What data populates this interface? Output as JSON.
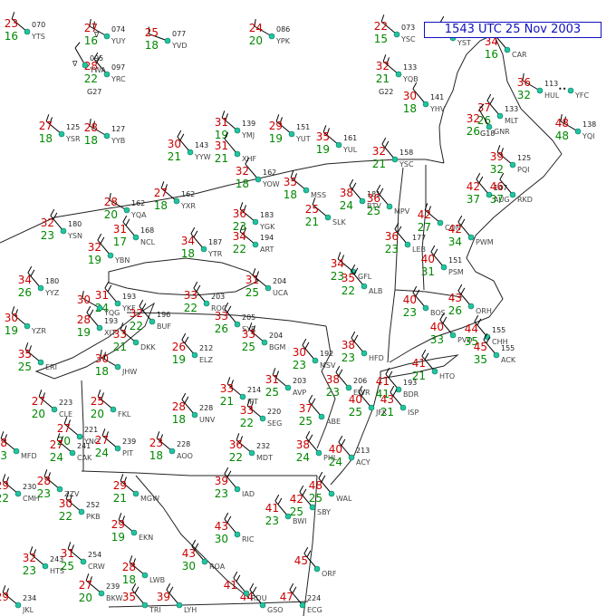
{
  "timestamp": "1543 UTC 25 Nov 2003",
  "colors": {
    "temperature": "#cc0000",
    "dewpoint": "#008800",
    "state_border": "#222222",
    "coastline": "#222222",
    "barb": "#000000",
    "station_dot": "#22c4a0",
    "timestamp_border": "#1010c0",
    "weather_symbol": "#aa00aa",
    "station_id": "#444444"
  },
  "stations": [
    {
      "id": "YTS",
      "t": "23",
      "d": "16",
      "p": "070"
    },
    {
      "id": "YUY",
      "t": "27",
      "d": "16",
      "p": "074",
      "wx": "∇"
    },
    {
      "id": "YVD",
      "t": "25",
      "d": "18",
      "p": "077"
    },
    {
      "id": "YPK",
      "t": "24",
      "d": "20",
      "p": "086"
    },
    {
      "id": "YRC",
      "t": "28",
      "d": "22",
      "p": "097",
      "g": "G27"
    },
    {
      "id": "YWA",
      "t": "",
      "d": "",
      "p": "095",
      "wx": "∇"
    },
    {
      "id": "YSC",
      "t": "22",
      "d": "15",
      "p": "073"
    },
    {
      "id": "YST",
      "t": "",
      "d": "",
      "p": "082"
    },
    {
      "id": "CAR",
      "t": "34",
      "d": "16",
      "p": ""
    },
    {
      "id": "HUL",
      "t": "36",
      "d": "32",
      "p": "113"
    },
    {
      "id": "YFC",
      "t": "",
      "d": "",
      "p": "",
      "wx": "••"
    },
    {
      "id": "YQB",
      "t": "32",
      "d": "21",
      "p": "133",
      "g": "G22"
    },
    {
      "id": "YHV",
      "t": "30",
      "d": "18",
      "p": "141"
    },
    {
      "id": "MLT",
      "t": "37",
      "d": "26",
      "p": "133",
      "g": "G18"
    },
    {
      "id": "GNR",
      "t": "32",
      "d": "26",
      "p": ""
    },
    {
      "id": "YQI",
      "t": "48",
      "d": "48",
      "p": "138"
    },
    {
      "id": "YSR",
      "t": "27",
      "d": "18",
      "p": "125"
    },
    {
      "id": "YYB",
      "t": "28",
      "d": "18",
      "p": "127"
    },
    {
      "id": "YMJ",
      "t": "31",
      "d": "19",
      "p": "139"
    },
    {
      "id": "YUT",
      "t": "29",
      "d": "19",
      "p": "151"
    },
    {
      "id": "YYW",
      "t": "30",
      "d": "21",
      "p": "143"
    },
    {
      "id": "XHF",
      "t": "31",
      "d": "21",
      "p": ""
    },
    {
      "id": "YUL",
      "t": "35",
      "d": "19",
      "p": "161"
    },
    {
      "id": "YSC",
      "t": "32",
      "d": "21",
      "p": "158"
    },
    {
      "id": "PQI",
      "t": "39",
      "d": "32",
      "p": "125"
    },
    {
      "id": "YOW",
      "t": "32",
      "d": "18",
      "p": "162"
    },
    {
      "id": "MSS",
      "t": "35",
      "d": "18",
      "p": ""
    },
    {
      "id": "SLK",
      "t": "25",
      "d": "21",
      "p": ""
    },
    {
      "id": "BTV",
      "t": "38",
      "d": "24",
      "p": "181"
    },
    {
      "id": "MPV",
      "t": "36",
      "d": "25",
      "p": ""
    },
    {
      "id": "AUG",
      "t": "42",
      "d": "37",
      "p": "147"
    },
    {
      "id": "RKD",
      "t": "46",
      "d": "37",
      "p": ""
    },
    {
      "id": "YXR",
      "t": "27",
      "d": "18",
      "p": "162"
    },
    {
      "id": "YQA",
      "t": "28",
      "d": "20",
      "p": "162"
    },
    {
      "id": "NCL",
      "t": "31",
      "d": "17",
      "p": "168"
    },
    {
      "id": "YBN",
      "t": "32",
      "d": "19",
      "p": ""
    },
    {
      "id": "YSN",
      "t": "32",
      "d": "23",
      "p": "180"
    },
    {
      "id": "YTR",
      "t": "34",
      "d": "18",
      "p": "187"
    },
    {
      "id": "ART",
      "t": "34",
      "d": "22",
      "p": "194"
    },
    {
      "id": "YGK",
      "t": "36",
      "d": "23",
      "p": "183"
    },
    {
      "id": "LEB",
      "t": "36",
      "d": "23",
      "p": "177"
    },
    {
      "id": "CON",
      "t": "42",
      "d": "27",
      "p": ""
    },
    {
      "id": "PSM",
      "t": "40",
      "d": "31",
      "p": "151"
    },
    {
      "id": "PWM",
      "t": "42",
      "d": "34",
      "p": ""
    },
    {
      "id": "YYZ",
      "t": "34",
      "d": "26",
      "p": "180"
    },
    {
      "id": "YKF",
      "t": "31",
      "d": "24",
      "p": "193"
    },
    {
      "id": "BUF",
      "t": "32",
      "d": "22",
      "p": "196"
    },
    {
      "id": "ROC",
      "t": "33",
      "d": "22",
      "p": "203"
    },
    {
      "id": "SYR",
      "t": "33",
      "d": "26",
      "p": "205"
    },
    {
      "id": "UCA",
      "t": "31",
      "d": "25",
      "p": "204"
    },
    {
      "id": "GFL",
      "t": "34",
      "d": "23",
      "p": ""
    },
    {
      "id": "BOS",
      "t": "40",
      "d": "23",
      "p": ""
    },
    {
      "id": "ORH",
      "t": "43",
      "d": "26",
      "p": ""
    },
    {
      "id": "XJT",
      "t": "28",
      "d": "19",
      "p": "193"
    },
    {
      "id": "YZR",
      "t": "30",
      "d": "19",
      "p": ""
    },
    {
      "id": "DKK",
      "t": "33",
      "d": "21",
      "p": ""
    },
    {
      "id": "JHW",
      "t": "30",
      "d": "18",
      "p": ""
    },
    {
      "id": "ELZ",
      "t": "26",
      "d": "19",
      "p": "212"
    },
    {
      "id": "BGM",
      "t": "33",
      "d": "25",
      "p": "204"
    },
    {
      "id": "ALB",
      "t": "35",
      "d": "22",
      "p": ""
    },
    {
      "id": "PVD",
      "t": "40",
      "d": "33",
      "p": ""
    },
    {
      "id": "CHH",
      "t": "44",
      "d": "35",
      "p": "155"
    },
    {
      "id": "ACK",
      "t": "45",
      "d": "35",
      "p": "155"
    },
    {
      "id": "YQG",
      "t": "30",
      "d": "",
      "p": ""
    },
    {
      "id": "ERI",
      "t": "35",
      "d": "25",
      "p": ""
    },
    {
      "id": "FKL",
      "t": "25",
      "d": "20",
      "p": ""
    },
    {
      "id": "IPT",
      "t": "33",
      "d": "21",
      "p": "214"
    },
    {
      "id": "AVP",
      "t": "31",
      "d": "25",
      "p": "203"
    },
    {
      "id": "MSV",
      "t": "30",
      "d": "23",
      "p": "192"
    },
    {
      "id": "HFD",
      "t": "38",
      "d": "23",
      "p": ""
    },
    {
      "id": "BDR",
      "t": "41",
      "d": "41",
      "p": "193"
    },
    {
      "id": "HTO",
      "t": "41",
      "d": "21",
      "p": ""
    },
    {
      "id": "ISP",
      "t": "43",
      "d": "21",
      "p": ""
    },
    {
      "id": "CLE",
      "t": "27",
      "d": "20",
      "p": "223"
    },
    {
      "id": "YNG",
      "t": "27",
      "d": "20",
      "p": "221"
    },
    {
      "id": "UNV",
      "t": "28",
      "d": "18",
      "p": "228"
    },
    {
      "id": "SEG",
      "t": "33",
      "d": "22",
      "p": "220"
    },
    {
      "id": "ABE",
      "t": "37",
      "d": "25",
      "p": ""
    },
    {
      "id": "EWR",
      "t": "38",
      "d": "23",
      "p": "206"
    },
    {
      "id": "JFK",
      "t": "40",
      "d": "25",
      "p": ""
    },
    {
      "id": "MFD",
      "t": "28",
      "d": "23",
      "p": ""
    },
    {
      "id": "CAK",
      "t": "27",
      "d": "24",
      "p": "241"
    },
    {
      "id": "PIT",
      "t": "27",
      "d": "24",
      "p": "239"
    },
    {
      "id": "AOO",
      "t": "23",
      "d": "18",
      "p": "228"
    },
    {
      "id": "MDT",
      "t": "36",
      "d": "22",
      "p": "232"
    },
    {
      "id": "PHL",
      "t": "38",
      "d": "24",
      "p": ""
    },
    {
      "id": "ACY",
      "t": "40",
      "d": "24",
      "p": "213"
    },
    {
      "id": "CMH",
      "t": "29",
      "d": "22",
      "p": "230"
    },
    {
      "id": "ZZV",
      "t": "28",
      "d": "23",
      "p": ""
    },
    {
      "id": "PKB",
      "t": "30",
      "d": "22",
      "p": "252"
    },
    {
      "id": "MGW",
      "t": "29",
      "d": "21",
      "p": ""
    },
    {
      "id": "EKN",
      "t": "29",
      "d": "19",
      "p": ""
    },
    {
      "id": "IAD",
      "t": "39",
      "d": "23",
      "p": ""
    },
    {
      "id": "BWI",
      "t": "41",
      "d": "23",
      "p": ""
    },
    {
      "id": "SBY",
      "t": "42",
      "d": "25",
      "p": ""
    },
    {
      "id": "WAL",
      "t": "48",
      "d": "25",
      "p": ""
    },
    {
      "id": "HTS",
      "t": "32",
      "d": "23",
      "p": "243"
    },
    {
      "id": "CRW",
      "t": "31",
      "d": "25",
      "p": "254"
    },
    {
      "id": "BKW",
      "t": "27",
      "d": "20",
      "p": "239"
    },
    {
      "id": "LWB",
      "t": "28",
      "d": "18",
      "p": ""
    },
    {
      "id": "ROA",
      "t": "43",
      "d": "30",
      "p": ""
    },
    {
      "id": "RIC",
      "t": "43",
      "d": "30",
      "p": ""
    },
    {
      "id": "ORF",
      "t": "45",
      "d": "",
      "p": ""
    },
    {
      "id": "LYH",
      "t": "39",
      "d": "",
      "p": ""
    },
    {
      "id": "JKL",
      "t": "29",
      "d": "",
      "p": "234"
    },
    {
      "id": "TRI",
      "t": "35",
      "d": "",
      "p": ""
    },
    {
      "id": "GSO",
      "t": "44",
      "d": "",
      "p": ""
    },
    {
      "id": "RDU",
      "t": "41",
      "d": "",
      "p": ""
    },
    {
      "id": "ECG",
      "t": "47",
      "d": "",
      "p": "224"
    }
  ]
}
